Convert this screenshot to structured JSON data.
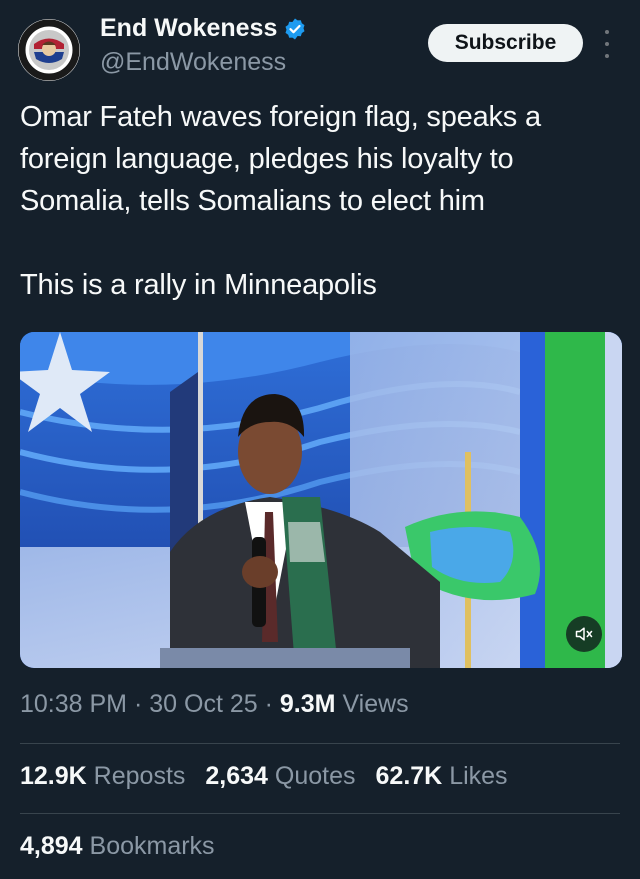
{
  "author": {
    "display_name": "End Wokeness",
    "handle": "@EndWokeness",
    "verified": true,
    "avatar_icon": "support-badge-avatar"
  },
  "actions": {
    "subscribe_label": "Subscribe",
    "more_icon": "more-vertical-icon"
  },
  "tweet": {
    "paragraphs": [
      "Omar Fateh waves foreign flag, speaks a foreign language, pledges his loyalty to Somalia, tells Somalians to elect him",
      "This is a rally in Minneapolis"
    ]
  },
  "media": {
    "type": "video",
    "mute_icon": "volume-muted-icon"
  },
  "meta": {
    "time": "10:38 PM",
    "date": "30 Oct 25",
    "views_count": "9.3M",
    "views_label": "Views",
    "separator": "·"
  },
  "stats": {
    "reposts": {
      "count": "12.9K",
      "label": "Reposts"
    },
    "quotes": {
      "count": "2,634",
      "label": "Quotes"
    },
    "likes": {
      "count": "62.7K",
      "label": "Likes"
    },
    "bookmarks": {
      "count": "4,894",
      "label": "Bookmarks"
    }
  },
  "colors": {
    "background": "#15202b",
    "text_primary": "#f7f9f9",
    "text_secondary": "#8b98a5",
    "verified_blue": "#1d9bf0",
    "divider": "#38444d"
  }
}
